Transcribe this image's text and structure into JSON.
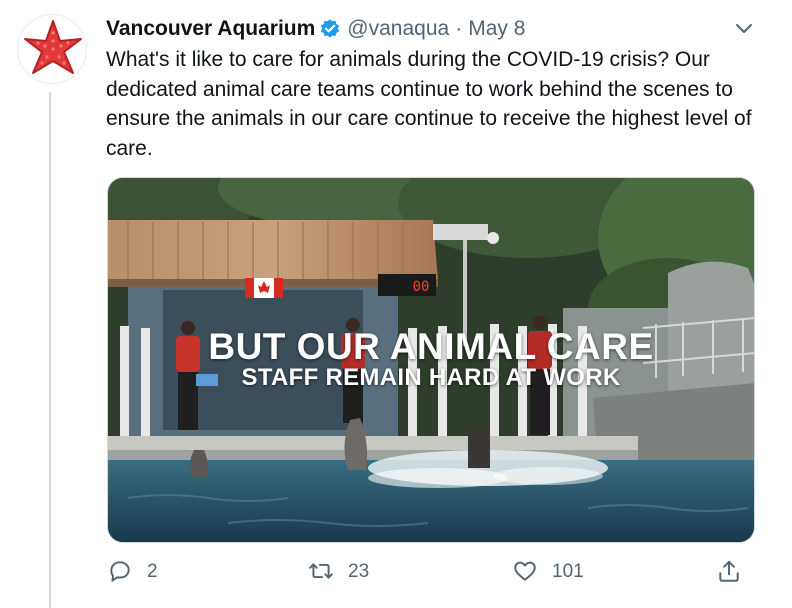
{
  "tweet": {
    "author_name": "Vancouver Aquarium",
    "handle": "@vanaqua",
    "separator": "·",
    "date": "May 8",
    "text": "What's it like to care for animals during the COVID-19 crisis? Our dedicated animal care teams continue to work behind the scenes to ensure the animals in our care continue to receive the highest level of care.",
    "verified": true,
    "avatar_icon": "red-starfish",
    "accent_color": "#1d9bf0"
  },
  "media": {
    "overlay_line1": "BUT OUR ANIMAL CARE",
    "overlay_line2": "STAFF REMAIN HARD AT WORK",
    "timer_text": "00"
  },
  "actions": {
    "reply_count": "2",
    "retweet_count": "23",
    "like_count": "101",
    "icons": [
      "reply-icon",
      "retweet-icon",
      "like-icon",
      "share-icon"
    ]
  }
}
